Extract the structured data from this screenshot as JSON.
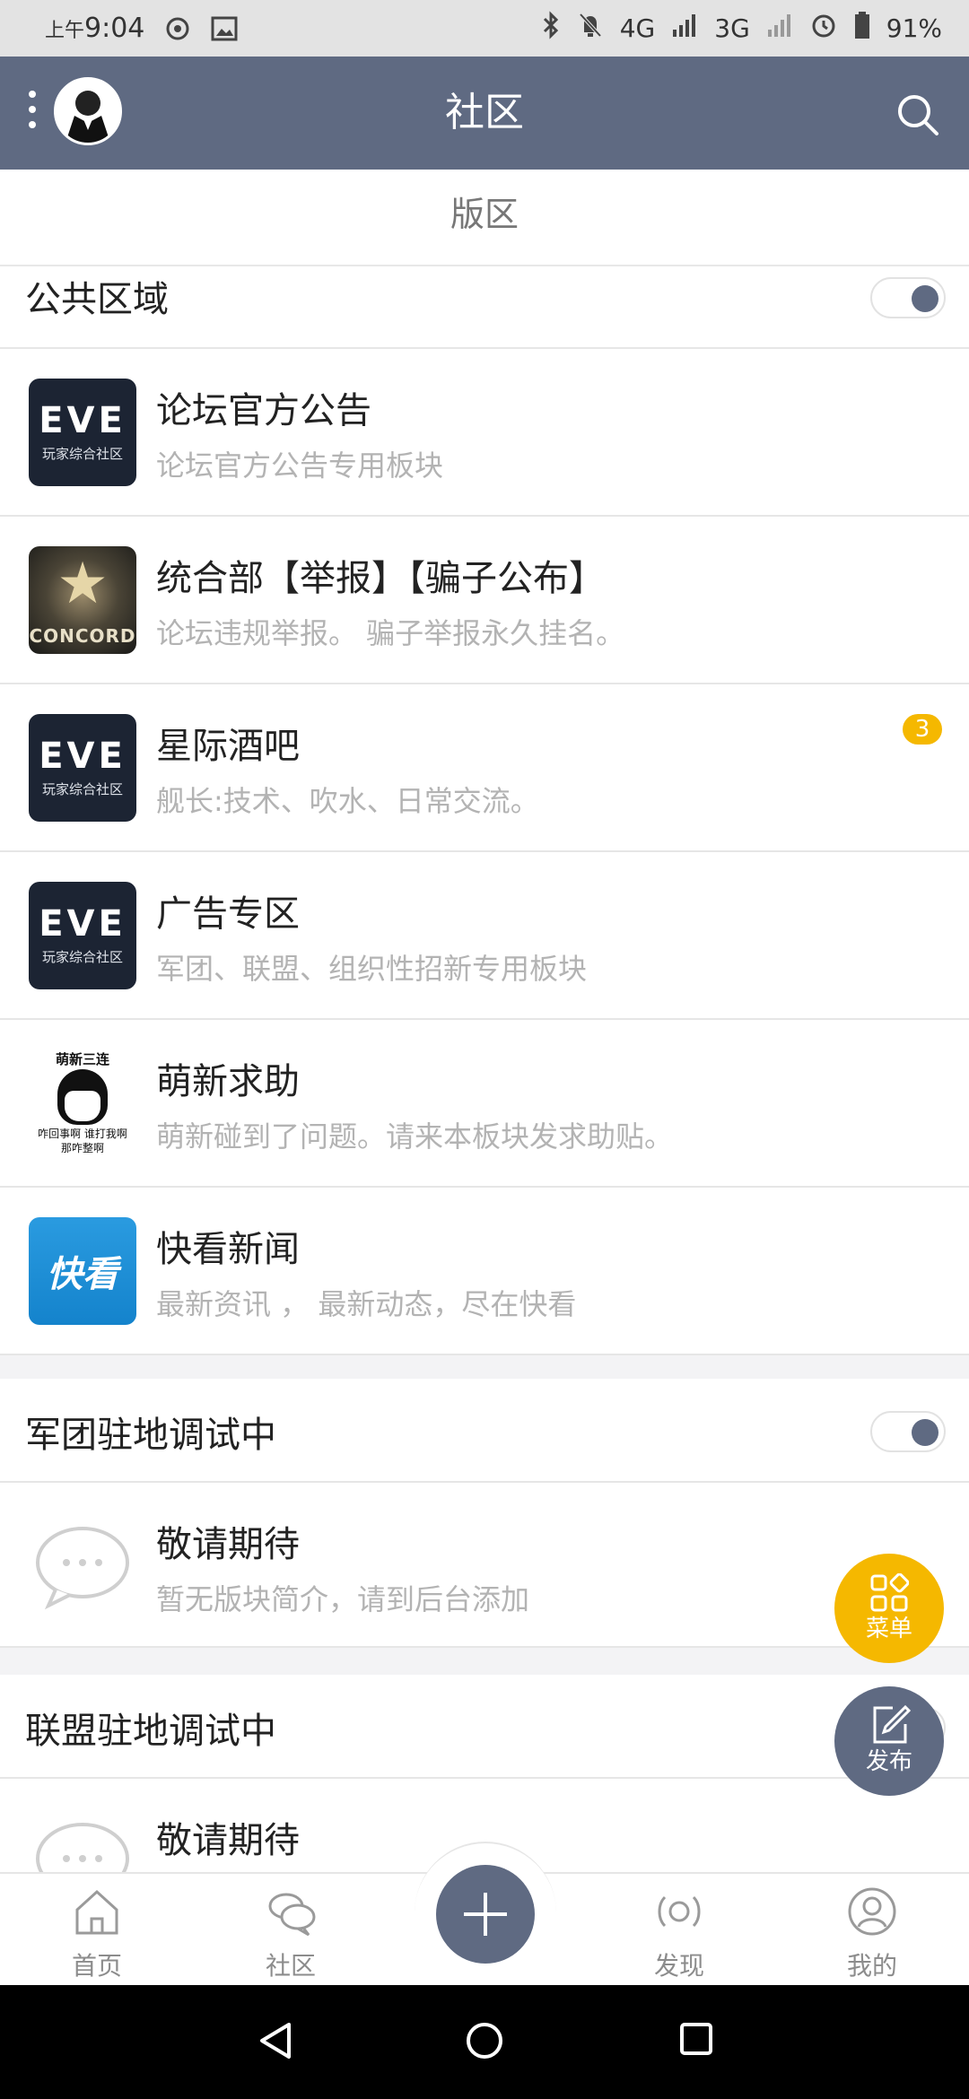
{
  "status_bar": {
    "time_prefix": "上午",
    "time": "9:04",
    "network_4g": "4G",
    "network_3g": "3G",
    "battery": "91%"
  },
  "app_bar": {
    "title": "社区"
  },
  "section_tab": "版区",
  "groups": [
    {
      "title": "公共区域",
      "toggle_on": true,
      "forums": [
        {
          "name": "论坛官方公告",
          "desc": "论坛官方公告专用板块",
          "icon": "eve-logo",
          "badge": ""
        },
        {
          "name": "统合部【举报】【骗子公布】",
          "desc": "论坛违规举报。 骗子举报永久挂名。",
          "icon": "concord-logo",
          "badge": ""
        },
        {
          "name": "星际酒吧",
          "desc": "舰长:技术、吹水、日常交流。",
          "icon": "eve-logo",
          "badge": "3"
        },
        {
          "name": "广告专区",
          "desc": "军团、联盟、组织性招新专用板块",
          "icon": "eve-logo",
          "badge": ""
        },
        {
          "name": "萌新求助",
          "desc": "萌新碰到了问题。请来本板块发求助贴。",
          "icon": "meme-image",
          "badge": ""
        },
        {
          "name": "快看新闻",
          "desc": "最新资讯 ， 最新动态，尽在快看",
          "icon": "kuaikan-logo",
          "badge": ""
        }
      ]
    },
    {
      "title": "军团驻地调试中",
      "toggle_on": true,
      "forums": [
        {
          "name": "敬请期待",
          "desc": "暂无版块简介，请到后台添加",
          "icon": "chat-bubble-icon",
          "badge": ""
        }
      ]
    },
    {
      "title": "联盟驻地调试中",
      "toggle_on": true,
      "forums": [
        {
          "name": "敬请期待",
          "desc": "",
          "icon": "chat-bubble-icon",
          "badge": ""
        }
      ]
    }
  ],
  "logos": {
    "eve_text": "EVE",
    "eve_sub": "玩家综合社区",
    "concord_text": "CONCORD",
    "meme_top": "萌新三连",
    "meme_line1": "咋回事啊 谁打我啊",
    "meme_line2": "那咋整啊",
    "kuaikan_text": "快看"
  },
  "fabs": {
    "menu_label": "菜单",
    "post_label": "发布"
  },
  "bottom_nav": [
    {
      "label": "首页",
      "icon": "home-icon"
    },
    {
      "label": "社区",
      "icon": "community-icon"
    },
    {
      "label": "",
      "icon": "plus-icon"
    },
    {
      "label": "发现",
      "icon": "discover-icon"
    },
    {
      "label": "我的",
      "icon": "profile-icon"
    }
  ],
  "colors": {
    "primary": "#5f6a82",
    "accent": "#f5b800",
    "desc_text": "#b3b3b3"
  }
}
